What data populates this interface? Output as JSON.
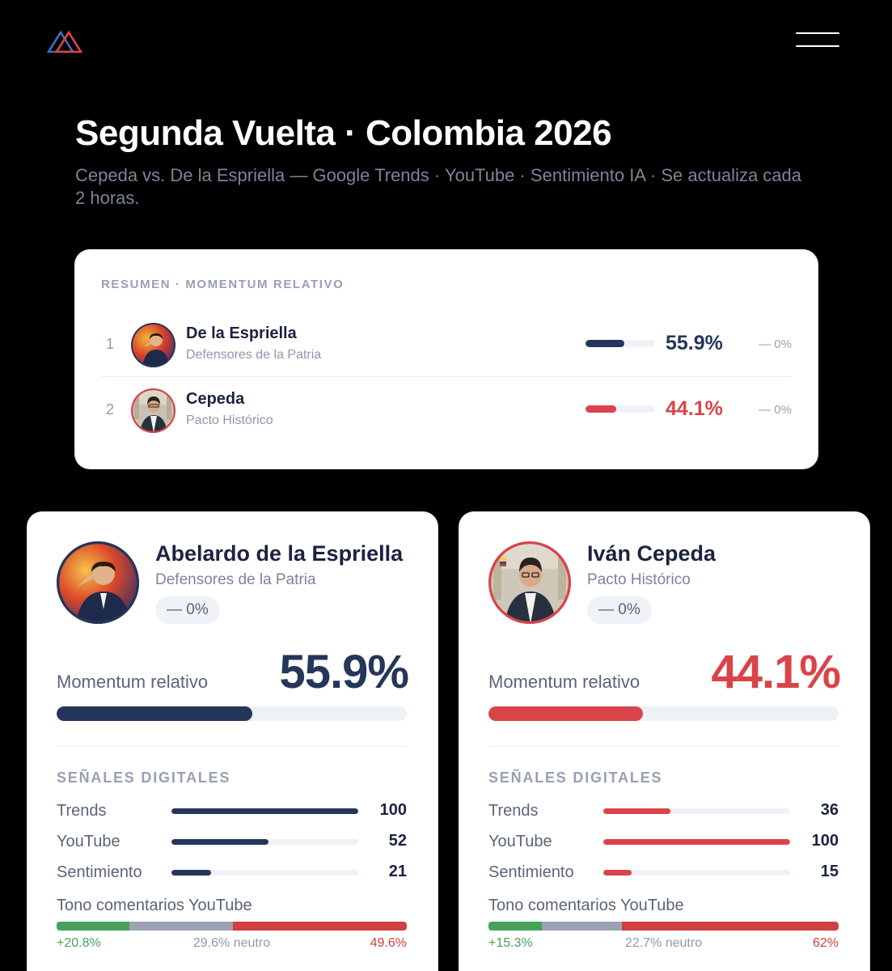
{
  "colors": {
    "navy": "#25365a",
    "red": "#d9444a",
    "background": "#000000",
    "card": "#ffffff"
  },
  "header": {
    "logo_icon": "triangle-logo-icon",
    "menu_icon": "hamburger-menu-icon",
    "title": "Segunda Vuelta · Colombia 2026",
    "subtitle": "Cepeda vs. De la Espriella — Google Trends · YouTube · Sentimiento IA · Se actualiza cada 2 horas."
  },
  "summary": {
    "heading": "RESUMEN · MOMENTUM RELATIVO",
    "rows": [
      {
        "rank": "1",
        "name": "De la Espriella",
        "party": "Defensores de la Patria",
        "percent": "55.9%",
        "change": "— 0%",
        "fill_fraction": 0.559
      },
      {
        "rank": "2",
        "name": "Cepeda",
        "party": "Pacto Histórico",
        "percent": "44.1%",
        "change": "— 0%",
        "fill_fraction": 0.441
      }
    ]
  },
  "candidates": [
    {
      "name": "Abelardo de la Espriella",
      "party": "Defensores de la Patria",
      "change": "— 0%",
      "momentum_label": "Momentum relativo",
      "momentum": "55.9%",
      "momentum_fraction": 0.559,
      "signals_heading": "SEÑALES DIGITALES",
      "signals": [
        {
          "label": "Trends",
          "value": "100",
          "fraction": 1.0
        },
        {
          "label": "YouTube",
          "value": "52",
          "fraction": 0.52
        },
        {
          "label": "Sentimiento",
          "value": "21",
          "fraction": 0.21
        }
      ],
      "tone_label": "Tono comentarios YouTube",
      "tone": {
        "positive": "+20.8%",
        "neutral": "29.6% neutro",
        "negative": "49.6%",
        "pos_pct": 20.8,
        "neu_pct": 29.6,
        "neg_pct": 49.6
      }
    },
    {
      "name": "Iván Cepeda",
      "party": "Pacto Histórico",
      "change": "— 0%",
      "momentum_label": "Momentum relativo",
      "momentum": "44.1%",
      "momentum_fraction": 0.441,
      "signals_heading": "SEÑALES DIGITALES",
      "signals": [
        {
          "label": "Trends",
          "value": "36",
          "fraction": 0.36
        },
        {
          "label": "YouTube",
          "value": "100",
          "fraction": 1.0
        },
        {
          "label": "Sentimiento",
          "value": "15",
          "fraction": 0.15
        }
      ],
      "tone_label": "Tono comentarios YouTube",
      "tone": {
        "positive": "+15.3%",
        "neutral": "22.7% neutro",
        "negative": "62%",
        "pos_pct": 15.3,
        "neu_pct": 22.7,
        "neg_pct": 62.0
      }
    }
  ]
}
